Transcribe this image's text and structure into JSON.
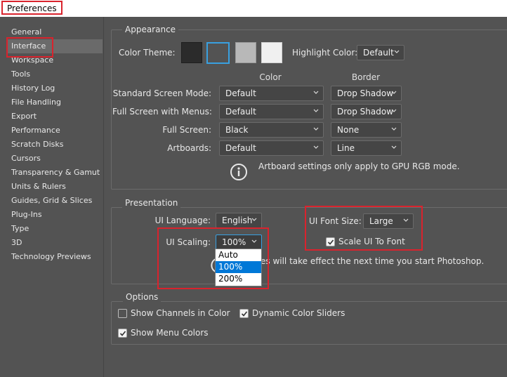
{
  "window": {
    "title": "Preferences"
  },
  "sidebar": {
    "items": [
      {
        "label": "General"
      },
      {
        "label": "Interface"
      },
      {
        "label": "Workspace"
      },
      {
        "label": "Tools"
      },
      {
        "label": "History Log"
      },
      {
        "label": "File Handling"
      },
      {
        "label": "Export"
      },
      {
        "label": "Performance"
      },
      {
        "label": "Scratch Disks"
      },
      {
        "label": "Cursors"
      },
      {
        "label": "Transparency & Gamut"
      },
      {
        "label": "Units & Rulers"
      },
      {
        "label": "Guides, Grid & Slices"
      },
      {
        "label": "Plug-Ins"
      },
      {
        "label": "Type"
      },
      {
        "label": "3D"
      },
      {
        "label": "Technology Previews"
      }
    ],
    "selected_index": 1
  },
  "appearance": {
    "group_title": "Appearance",
    "color_theme_label": "Color Theme:",
    "theme_swatches": [
      "#2b2b2b",
      "#535353",
      "#b8b8b8",
      "#f0f0f0"
    ],
    "selected_theme_index": 1,
    "highlight_label": "Highlight Color:",
    "highlight_value": "Default",
    "col_color": "Color",
    "col_border": "Border",
    "rows": [
      {
        "label": "Standard Screen Mode:",
        "color": "Default",
        "border": "Drop Shadow"
      },
      {
        "label": "Full Screen with Menus:",
        "color": "Default",
        "border": "Drop Shadow"
      },
      {
        "label": "Full Screen:",
        "color": "Black",
        "border": "None"
      },
      {
        "label": "Artboards:",
        "color": "Default",
        "border": "Line"
      }
    ],
    "info_text": "Artboard settings only apply to GPU RGB mode."
  },
  "presentation": {
    "group_title": "Presentation",
    "ui_language_label": "UI Language:",
    "ui_language_value": "English",
    "ui_font_size_label": "UI Font Size:",
    "ui_font_size_value": "Large",
    "scale_ui_label": "Scale UI To Font",
    "ui_scaling_label": "UI Scaling:",
    "ui_scaling_value": "100%",
    "scaling_options": [
      "Auto",
      "100%",
      "200%"
    ],
    "restart_note": "es will take effect the next time you start Photoshop."
  },
  "options": {
    "group_title": "Options",
    "show_channels": "Show Channels in Color",
    "dynamic_sliders": "Dynamic Color Sliders",
    "show_menu_colors": "Show Menu Colors"
  },
  "colors": {
    "accent": "#0078d7",
    "annotation_red": "#d9232d",
    "theme_selected_border": "#39a0e0"
  }
}
